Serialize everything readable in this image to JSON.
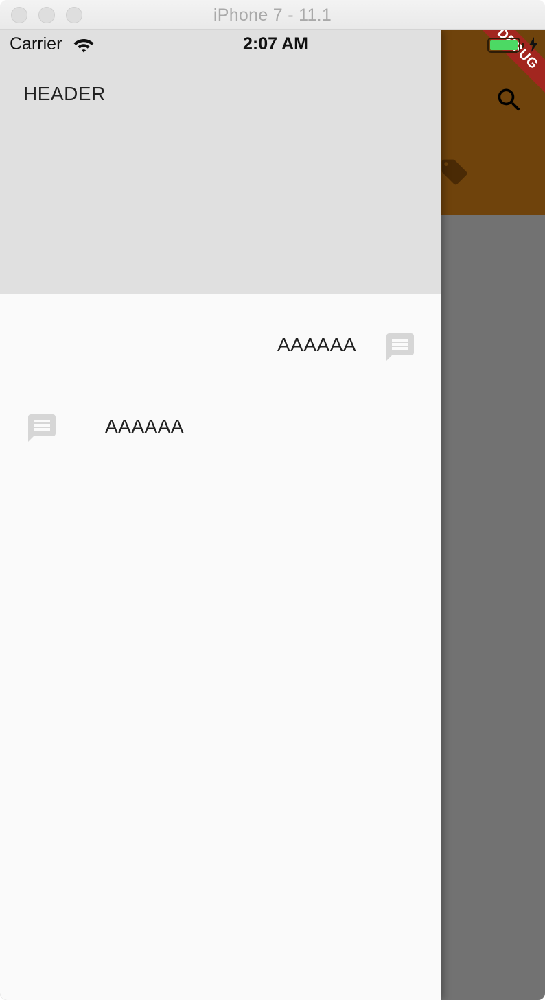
{
  "window": {
    "title": "iPhone 7 - 11.1"
  },
  "status_bar": {
    "carrier": "Carrier",
    "time": "2:07 AM"
  },
  "app_bar": {
    "debug_banner": "DEBUG",
    "icons": [
      "search-icon",
      "tag-icon"
    ],
    "color": "#6f430c"
  },
  "drawer": {
    "header": {
      "title": "HEADER",
      "background": "#e0e0e0"
    },
    "items": [
      {
        "label": "AAAAAA",
        "icon": "message-icon",
        "icon_side": "right"
      },
      {
        "label": "AAAAAA",
        "icon": "message-icon",
        "icon_side": "left"
      }
    ]
  },
  "colors": {
    "scrim": "#727272",
    "drawer_bg": "#fafafa",
    "icon_gray": "#d6d6d6",
    "debug_red": "#a2261f",
    "battery_green": "#4cd964"
  }
}
